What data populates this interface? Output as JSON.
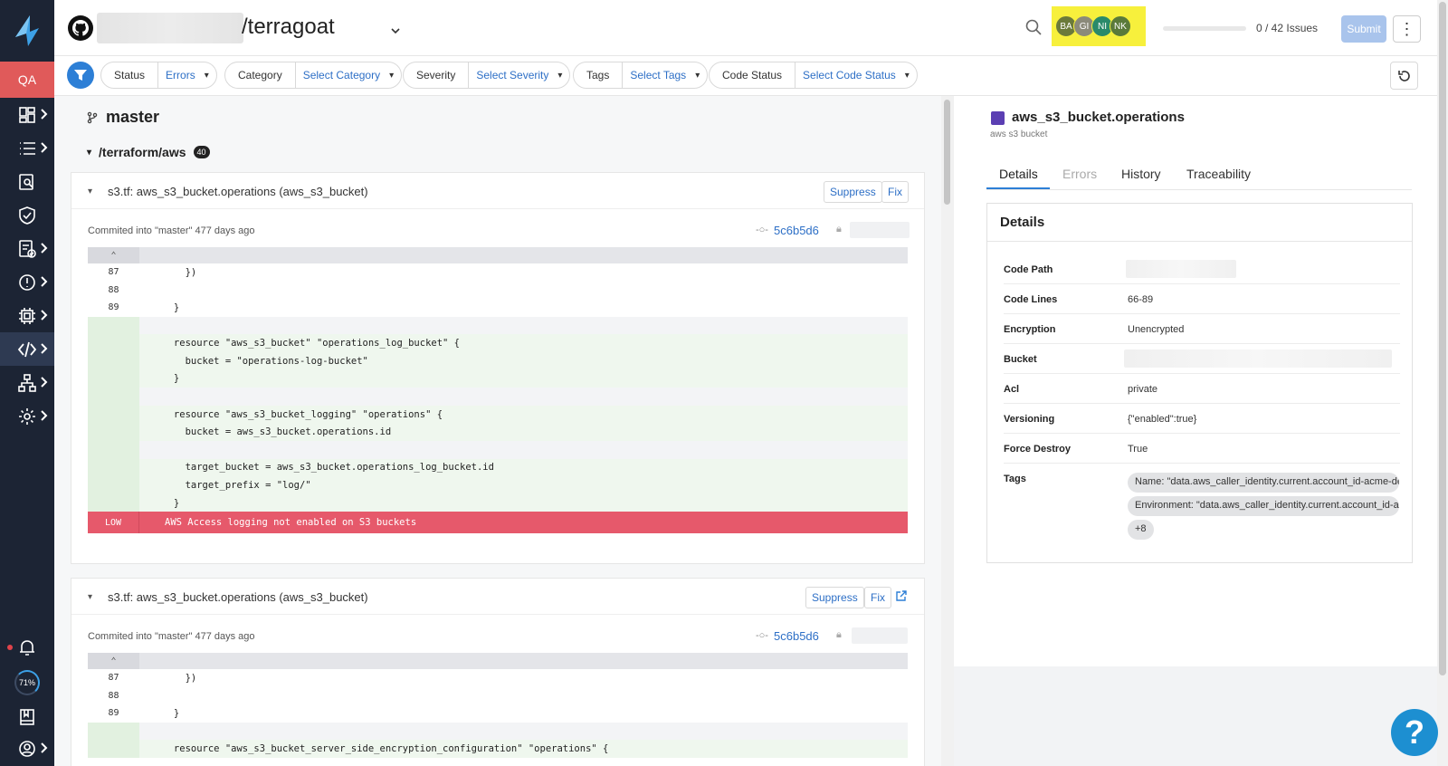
{
  "sidebar": {
    "qa_label": "QA",
    "progress": "71%",
    "items": [
      "dashboard-icon",
      "list-icon",
      "search-doc-icon",
      "shield-icon",
      "report-icon",
      "alert-icon",
      "chip-icon",
      "code-icon",
      "network-icon",
      "gear-icon"
    ],
    "active_item": "code-icon"
  },
  "header": {
    "repo_name": "/terragoat",
    "avatars": [
      {
        "initials": "BA",
        "color": "#6b7a3a"
      },
      {
        "initials": "GI",
        "color": "#8b8a7a"
      },
      {
        "initials": "NI",
        "color": "#2a8a6a"
      },
      {
        "initials": "NK",
        "color": "#5a7a3a"
      }
    ],
    "issues_text": "0 / 42 Issues",
    "issues_progress": 0,
    "submit_label": "Submit",
    "kebab": "⋮"
  },
  "filters": [
    {
      "label": "Status",
      "value": "Errors"
    },
    {
      "label": "Category",
      "value": "Select Category"
    },
    {
      "label": "Severity",
      "value": "Select Severity"
    },
    {
      "label": "Tags",
      "value": "Select Tags"
    },
    {
      "label": "Code Status",
      "value": "Select Code Status"
    }
  ],
  "main": {
    "branch": "master",
    "folder": "/terraform/aws",
    "folder_count": "40",
    "cards": [
      {
        "title": "s3.tf: aws_s3_bucket.operations (aws_s3_bucket)",
        "suppress": "Suppress",
        "fix": "Fix",
        "commit": "Commited into \"master\" 477 days ago",
        "sha": "5c6b5d6",
        "lines": [
          {
            "n": "87",
            "t": "        })"
          },
          {
            "n": "88",
            "t": ""
          },
          {
            "n": "89",
            "t": "      }"
          },
          {
            "n": "",
            "t": ""
          },
          {
            "n": "",
            "t": "      resource \"aws_s3_bucket\" \"operations_log_bucket\" {"
          },
          {
            "n": "",
            "t": "        bucket = \"operations-log-bucket\""
          },
          {
            "n": "",
            "t": "      }"
          },
          {
            "n": "",
            "t": ""
          },
          {
            "n": "",
            "t": "      resource \"aws_s3_bucket_logging\" \"operations\" {"
          },
          {
            "n": "",
            "t": "        bucket = aws_s3_bucket.operations.id"
          },
          {
            "n": "",
            "t": ""
          },
          {
            "n": "",
            "t": "        target_bucket = aws_s3_bucket.operations_log_bucket.id"
          },
          {
            "n": "",
            "t": "        target_prefix = \"log/\""
          },
          {
            "n": "",
            "t": "      }"
          }
        ],
        "error_severity": "LOW",
        "error_text": "AWS Access logging not enabled on S3 buckets"
      },
      {
        "title": "s3.tf: aws_s3_bucket.operations (aws_s3_bucket)",
        "suppress": "Suppress",
        "fix": "Fix",
        "commit": "Commited into \"master\" 477 days ago",
        "sha": "5c6b5d6",
        "lines": [
          {
            "n": "87",
            "t": "        })"
          },
          {
            "n": "88",
            "t": ""
          },
          {
            "n": "89",
            "t": "      }"
          },
          {
            "n": "",
            "t": ""
          },
          {
            "n": "",
            "t": "      resource \"aws_s3_bucket_server_side_encryption_configuration\" \"operations\" {"
          }
        ]
      }
    ]
  },
  "details": {
    "resource_name": "aws_s3_bucket.operations",
    "resource_type": "aws s3 bucket",
    "tabs": [
      "Details",
      "Errors",
      "History",
      "Traceability"
    ],
    "active_tab": "Details",
    "panel_title": "Details",
    "rows": [
      {
        "key": "Code Path",
        "value": ""
      },
      {
        "key": "Code Lines",
        "value": "66-89"
      },
      {
        "key": "Encryption",
        "value": "Unencrypted"
      },
      {
        "key": "Bucket",
        "value": ""
      },
      {
        "key": "Acl",
        "value": "private"
      },
      {
        "key": "Versioning",
        "value": "{\"enabled\":true}"
      },
      {
        "key": "Force Destroy",
        "value": "True"
      },
      {
        "key": "Tags",
        "value": ""
      }
    ],
    "tags": [
      "Name: \"data.aws_caller_identity.current.account_id-acme-dev",
      "Environment: \"data.aws_caller_identity.current.account_id-a",
      "+8"
    ]
  },
  "help_label": "?"
}
